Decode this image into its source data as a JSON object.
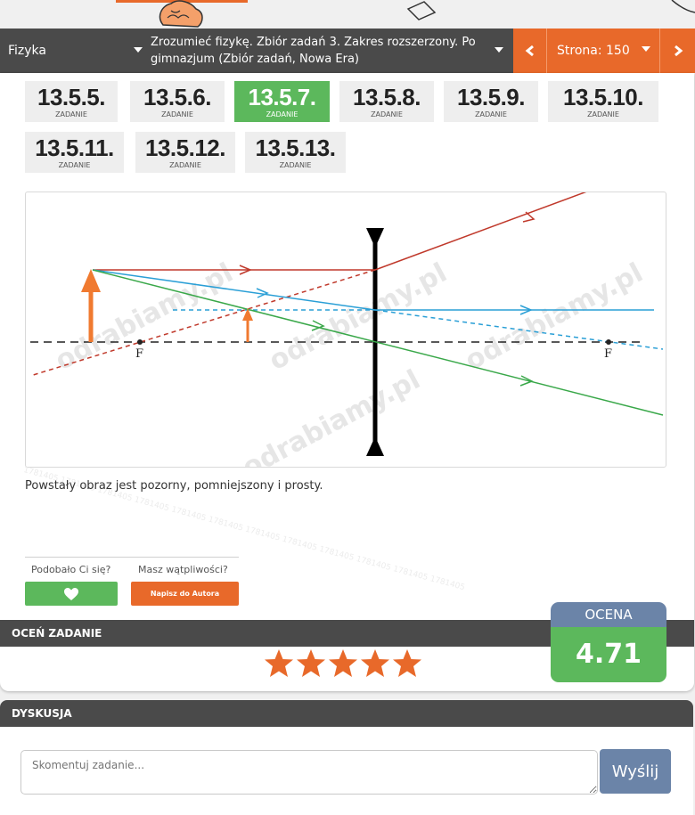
{
  "nav": {
    "subject": "Fizyka",
    "book": "Zrozumieć fizykę. Zbiór zadań 3. Zakres rozszerzony. Po gimnazjum (Zbiór zadań, Nowa Era)",
    "page": "Strona: 150"
  },
  "tasks": [
    {
      "num": "13.5.5.",
      "label": "ZADANIE"
    },
    {
      "num": "13.5.6.",
      "label": "ZADANIE"
    },
    {
      "num": "13.5.7.",
      "label": "ZADANIE"
    },
    {
      "num": "13.5.8.",
      "label": "ZADANIE"
    },
    {
      "num": "13.5.9.",
      "label": "ZADANIE"
    },
    {
      "num": "13.5.10.",
      "label": "ZADANIE"
    },
    {
      "num": "13.5.11.",
      "label": "ZADANIE"
    },
    {
      "num": "13.5.12.",
      "label": "ZADANIE"
    },
    {
      "num": "13.5.13.",
      "label": "ZADANIE"
    }
  ],
  "active_task": "13.5.7.",
  "figure": {
    "focus_left": "F",
    "focus_right": "F",
    "watermark": "odrabiamy.pl"
  },
  "answer": "Powstały obraz jest pozorny, pomniejszony i prosty.",
  "answer_watermark": "1781405 1781405 1781405 1781405 1781405 1781405 1781405 1781405 1781405 1781405 1781405 1781405",
  "feedback": {
    "liked": "Podobało Ci się?",
    "doubts": "Masz wątpliwości?",
    "write_author": "Napisz do Autora"
  },
  "rate": {
    "title": "OCEŃ ZADANIE",
    "stars": 5
  },
  "score": {
    "label": "OCENA",
    "value": "4.71"
  },
  "discussion": {
    "title": "DYSKUSJA",
    "placeholder": "Skomentuj zadanie...",
    "send": "Wyślij"
  },
  "colors": {
    "orange": "#e8692a",
    "green": "#5cb85c",
    "dark": "#4a4a4a",
    "blue": "#6b84a8",
    "ray_red": "#c0392b",
    "ray_blue": "#2a9fd6",
    "ray_green": "#3aa84a"
  }
}
